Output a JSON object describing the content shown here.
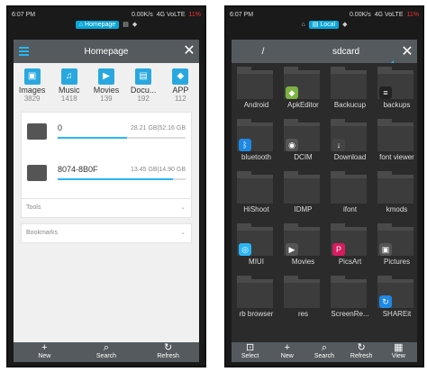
{
  "left": {
    "status": {
      "time": "6:07 PM",
      "speed": "0.00K/s",
      "network": "4G VoLTE",
      "battery": "11%"
    },
    "tabstrip": {
      "active_tab": "Homepage"
    },
    "appbar": {
      "title": "Homepage"
    },
    "categories": [
      {
        "label": "Images",
        "count": "3829",
        "icon": "image-icon"
      },
      {
        "label": "Music",
        "count": "1418",
        "icon": "music-icon"
      },
      {
        "label": "Movies",
        "count": "139",
        "icon": "video-icon"
      },
      {
        "label": "Docu...",
        "count": "192",
        "icon": "document-icon"
      },
      {
        "label": "APP",
        "count": "112",
        "icon": "android-icon"
      }
    ],
    "devices": [
      {
        "name": "0",
        "size": "28.21 GB|52.16 GB",
        "used_fraction": 0.54
      },
      {
        "name": "8074-8B0F",
        "size": "13.45 GB|14.90 GB",
        "used_fraction": 0.9
      }
    ],
    "sections": {
      "tools": "Tools",
      "bookmarks": "Bookmarks"
    },
    "bottombar": {
      "new": "New",
      "search": "Search",
      "refresh": "Refresh"
    }
  },
  "right": {
    "status": {
      "time": "6:07 PM",
      "speed": "0.00K/s",
      "network": "4G VoLTE",
      "battery": "11%"
    },
    "tabstrip": {
      "active_tab": "Local"
    },
    "pathbar": {
      "root": "/",
      "current": "sdcard"
    },
    "folders": [
      {
        "name": "Android",
        "badge": ""
      },
      {
        "name": "ApkEditor",
        "badge": "android"
      },
      {
        "name": "Backucup",
        "badge": ""
      },
      {
        "name": "backups",
        "badge": "backup"
      },
      {
        "name": "bluetooth",
        "badge": "bluetooth"
      },
      {
        "name": "DCIM",
        "badge": "camera"
      },
      {
        "name": "Download",
        "badge": "download"
      },
      {
        "name": "font viewer",
        "badge": ""
      },
      {
        "name": "HiShoot",
        "badge": ""
      },
      {
        "name": "IDMP",
        "badge": ""
      },
      {
        "name": "ifont",
        "badge": ""
      },
      {
        "name": "kmods",
        "badge": ""
      },
      {
        "name": "MIUI",
        "badge": "miui"
      },
      {
        "name": "Movies",
        "badge": "movie"
      },
      {
        "name": "PicsArt",
        "badge": "picsart"
      },
      {
        "name": "Pictures",
        "badge": "picture"
      },
      {
        "name": "rb browser",
        "badge": ""
      },
      {
        "name": "res",
        "badge": ""
      },
      {
        "name": "ScreenRe...",
        "badge": ""
      },
      {
        "name": "SHAREit",
        "badge": "shareit"
      }
    ],
    "bottombar": {
      "select": "Select",
      "new": "New",
      "search": "Search",
      "refresh": "Refresh",
      "view": "View"
    }
  }
}
